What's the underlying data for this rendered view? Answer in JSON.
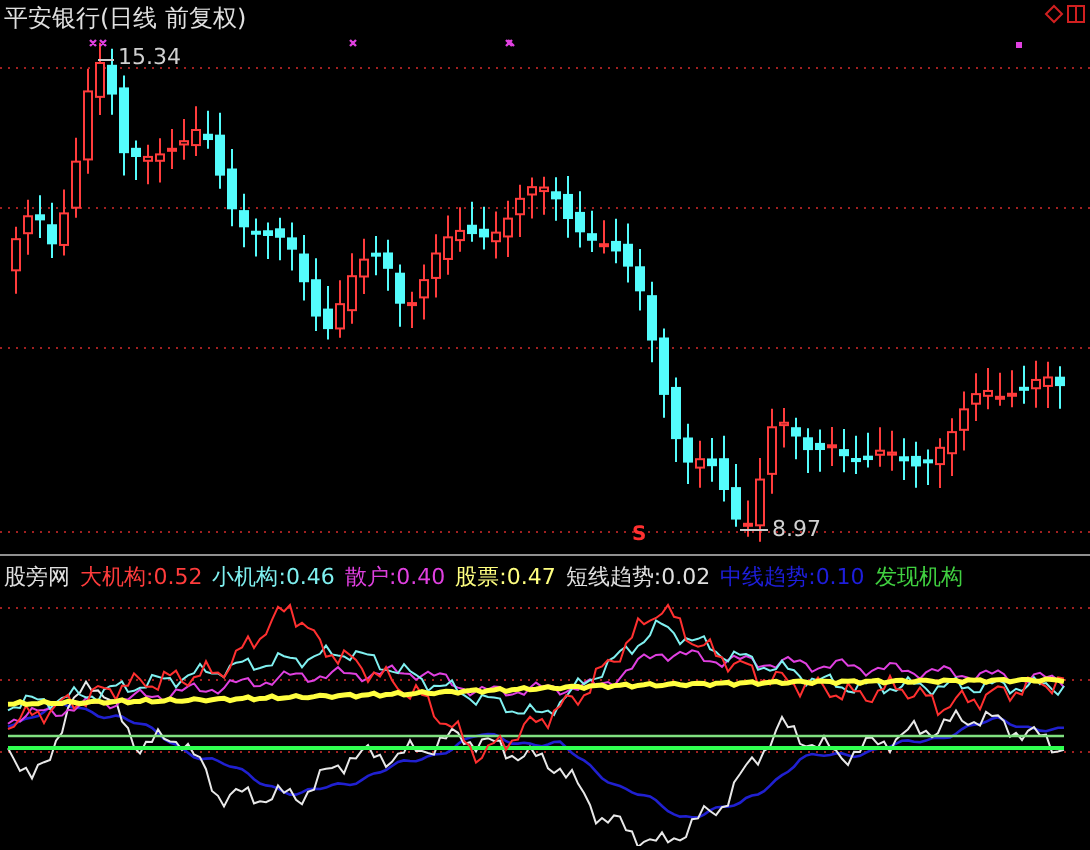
{
  "chart_title": "平安银行(日线 前复权)",
  "price_marks": {
    "high": "15.34",
    "low": "8.97",
    "signal": "S"
  },
  "legend": [
    {
      "label": "股旁网",
      "color": "#e0e0e0"
    },
    {
      "label": "大机构:",
      "value": "0.52",
      "color": "#ff3c3c"
    },
    {
      "label": "小机构:",
      "value": "0.46",
      "color": "#7ff0f0"
    },
    {
      "label": "散户:",
      "value": "0.40",
      "color": "#e040e0"
    },
    {
      "label": "股票:",
      "value": "0.47",
      "color": "#ffff80"
    },
    {
      "label": "短线趋势:",
      "value": "0.02",
      "color": "#e0e0e0"
    },
    {
      "label": "中线趋势:",
      "value": "0.10",
      "color": "#1e1edc"
    },
    {
      "label": "发现机构",
      "color": "#40d040"
    }
  ]
}
